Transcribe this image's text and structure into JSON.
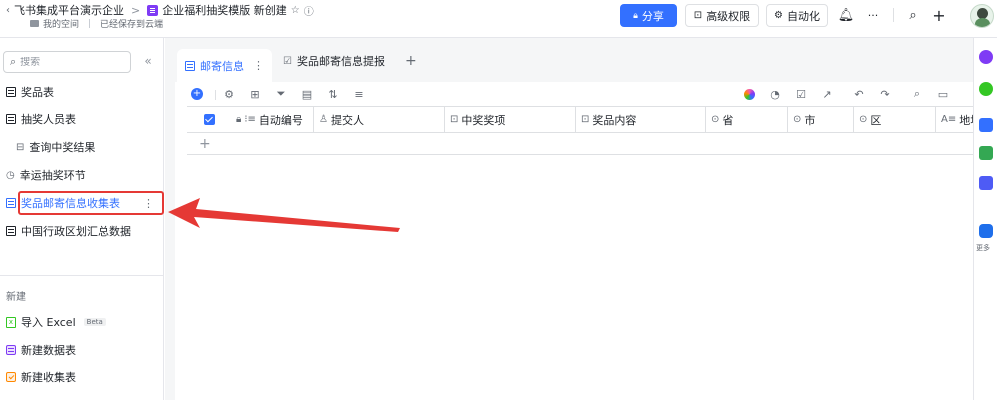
{
  "header": {
    "breadcrumb_parent": "飞书集成平台演示企业",
    "breadcrumb_sep": ">",
    "doc_title": "企业福利抽奖模版 新创建",
    "location": "我的空间",
    "save_status": "已经保存到云端",
    "share_label": "分享",
    "advanced_perm_label": "高级权限",
    "automation_label": "自动化",
    "more_label": "···",
    "brand_color": "#3370ff"
  },
  "sidebar": {
    "search_placeholder": "搜索",
    "items": [
      {
        "label": "奖品表",
        "icon": "table-icon"
      },
      {
        "label": "抽奖人员表",
        "icon": "table-icon"
      },
      {
        "label": "查询中奖结果",
        "icon": "dashboard-icon"
      },
      {
        "label": "幸运抽奖环节",
        "icon": "workflow-icon"
      },
      {
        "label": "奖品邮寄信息收集表",
        "icon": "table-icon",
        "active": true
      },
      {
        "label": "中国行政区划汇总数据",
        "icon": "table-icon"
      }
    ],
    "new_section_label": "新建",
    "new_items": [
      {
        "label": "导入 Excel",
        "badge": "Beta"
      },
      {
        "label": "新建数据表"
      },
      {
        "label": "新建收集表"
      }
    ],
    "highlight_color": "#e53935"
  },
  "tabs": [
    {
      "label": "邮寄信息",
      "active": true
    },
    {
      "label": "奖品邮寄信息提报",
      "active": false
    }
  ],
  "grid": {
    "columns": [
      {
        "label": "自动编号",
        "icon": "autonumber-icon"
      },
      {
        "label": "提交人",
        "icon": "person-icon"
      },
      {
        "label": "中奖奖项",
        "icon": "lookup-icon"
      },
      {
        "label": "奖品内容",
        "icon": "lookup-icon"
      },
      {
        "label": "省",
        "icon": "single-select-icon"
      },
      {
        "label": "市",
        "icon": "single-select-icon"
      },
      {
        "label": "区",
        "icon": "single-select-icon"
      },
      {
        "label": "地址",
        "icon": "text-icon"
      }
    ],
    "add_row_label": "+"
  },
  "rail": {
    "more_label": "更多"
  }
}
